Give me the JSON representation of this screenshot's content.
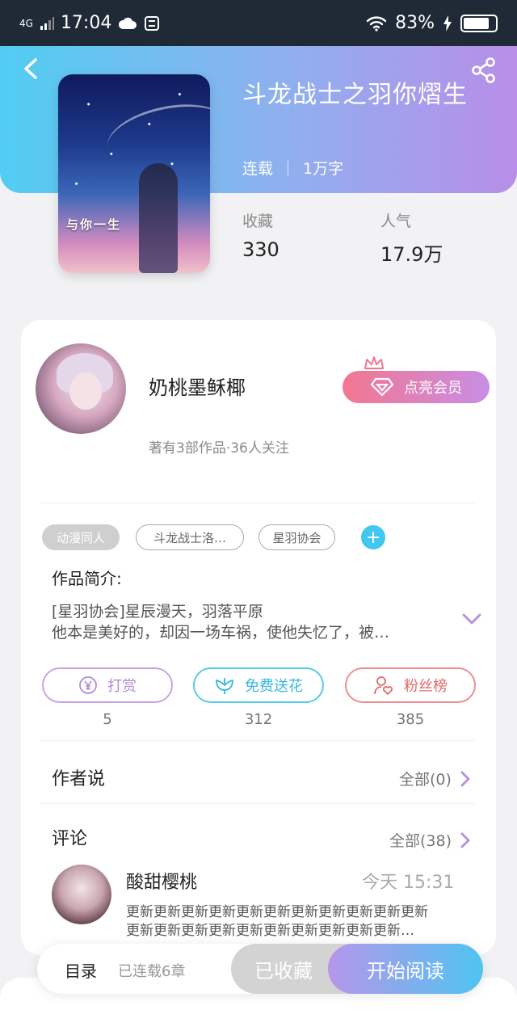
{
  "status_bar": {
    "network": "4G",
    "time": "17:04",
    "battery": "83%",
    "battery_level": 0.83
  },
  "book": {
    "title": "斗龙战士之羽你熠生",
    "status": "连载",
    "word_count": "1万字",
    "cover_text": "与你一生",
    "favorites_label": "收藏",
    "favorites_value": "330",
    "popularity_label": "人气",
    "popularity_value": "17.9万"
  },
  "author": {
    "name": "奶桃墨稣椰",
    "subtitle": "著有3部作品·36人关注",
    "member_button": "点亮会员"
  },
  "tags": [
    "动漫同人",
    "斗龙战士洛…",
    "星羽协会"
  ],
  "intro": {
    "title": "作品简介:",
    "line1": "[星羽协会]星辰漫天，羽落平原",
    "line2": "他本是美好的，却因一场车祸，使他失忆了，被…"
  },
  "actions": {
    "tip_label": "打赏",
    "tip_count": "5",
    "flower_label": "免费送花",
    "flower_count": "312",
    "fans_label": "粉丝榜",
    "fans_count": "385"
  },
  "author_says": {
    "title": "作者说",
    "link": "全部(0)"
  },
  "comments": {
    "title": "评论",
    "link": "全部(38)",
    "items": [
      {
        "user": "酸甜樱桃",
        "time": "今天 15:31",
        "line1": "更新更新更新更新更新更新更新更新更新更新更新",
        "line2": "更新更新更新更新更新更新更新更新更新更新…"
      }
    ]
  },
  "bottom_bar": {
    "toc": "目录",
    "chapters": "已连载6章",
    "collected": "已收藏",
    "start_reading": "开始阅读"
  },
  "colors": {
    "header_gradient_start": "#51cdf3",
    "header_gradient_end": "#b88ee9",
    "accent_blue": "#42c7f1",
    "accent_purple": "#b08bd6",
    "accent_red": "#e26a6a"
  },
  "icons": {
    "back": "chevron-left-icon",
    "share": "share-icon",
    "member": "diamond-icon",
    "crown": "crown-icon",
    "tip": "yen-coin-icon",
    "flower": "flower-icon",
    "fans": "user-heart-icon",
    "expand": "chevron-down-icon",
    "more": "chevron-right-icon",
    "add_tag": "plus-icon"
  }
}
